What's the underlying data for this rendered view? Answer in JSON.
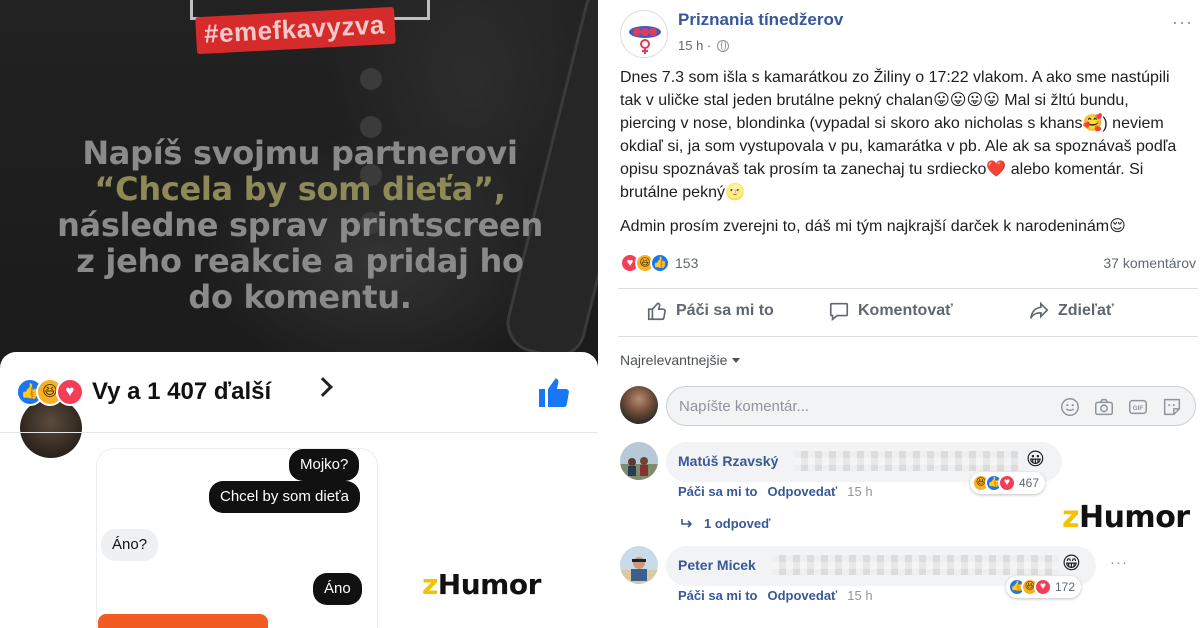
{
  "left": {
    "hashtag": "#emefkavyzva",
    "headline": {
      "line1": "Napíš svojmu partnerovi",
      "quote": "“Chcela by som dieťa”,",
      "line3": "následne sprav printscreen",
      "line4": "z jeho reakcie a pridaj ho",
      "line5": "do komentu."
    },
    "reactions_text": "Vy a 1 407 ďalší",
    "chat": {
      "messages": [
        {
          "text": "Mojko?",
          "side": "out"
        },
        {
          "text": "Chcel by som dieťa",
          "side": "out"
        },
        {
          "text": "Áno?",
          "side": "in"
        },
        {
          "text": "Áno",
          "side": "out"
        }
      ]
    },
    "watermark": {
      "z": "z",
      "text": "Humor"
    }
  },
  "post": {
    "page_name": "Priznania tínedžerov",
    "time": "15 h ·",
    "paragraph1": "Dnes 7.3 som išla s kamarátkou zo Žiliny o 17:22 vlakom. A ako sme nastúpili tak v uličke stal jeden brutálne pekný chalan😛😛😛😛 Mal si žltú bundu, piercing v nose, blondinka (vypadal si skoro ako nicholas s khans🥰) neviem okdiaľ si, ja som vystupovala v pu, kamarátka v pb. Ale ak sa spoznávaš podľa opisu spoznávaš tak prosím ta zanechaj tu srdiecko❤️ alebo komentár. Si brutálne pekný🌝",
    "paragraph2": "Admin prosím zverejni to, dáš mi tým najkrajší darček k narodeninám😌",
    "reactions_count": "153",
    "comments_count": "37 komentárov",
    "actions": {
      "like": "Páči sa mi to",
      "comment": "Komentovať",
      "share": "Zdieľať"
    },
    "sort": "Najrelevantnejšie",
    "comment_placeholder": "Napíšte komentár..."
  },
  "comments": [
    {
      "name": "Matúš Rzavský",
      "emoji": "😀",
      "like_label": "Páči sa mi to",
      "reply_label": "Odpovedať",
      "time": "15 h",
      "reactions": "467",
      "replies": "1 odpoveď"
    },
    {
      "name": "Peter Micek",
      "emoji": "😁",
      "like_label": "Páči sa mi to",
      "reply_label": "Odpovedať",
      "time": "15 h",
      "reactions": "172"
    }
  ],
  "watermark_right": {
    "z": "z",
    "text": "Humor"
  },
  "icons": {
    "left_reactions": [
      "like-icon",
      "haha-icon",
      "love-icon"
    ],
    "post_reactions": [
      "love-icon",
      "haha-icon",
      "like-icon"
    ],
    "comment1_reactions": [
      "haha-icon",
      "like-icon",
      "love-icon"
    ],
    "comment2_reactions": [
      "like-icon",
      "haha-icon",
      "love-icon"
    ]
  },
  "colors": {
    "facebook_blue": "#1877f2",
    "link_blue": "#365899",
    "love_red": "#f33e58",
    "haha_yellow": "#f7b125",
    "hashtag_red": "#d62b2b",
    "watermark_yellow": "#f3c200"
  }
}
